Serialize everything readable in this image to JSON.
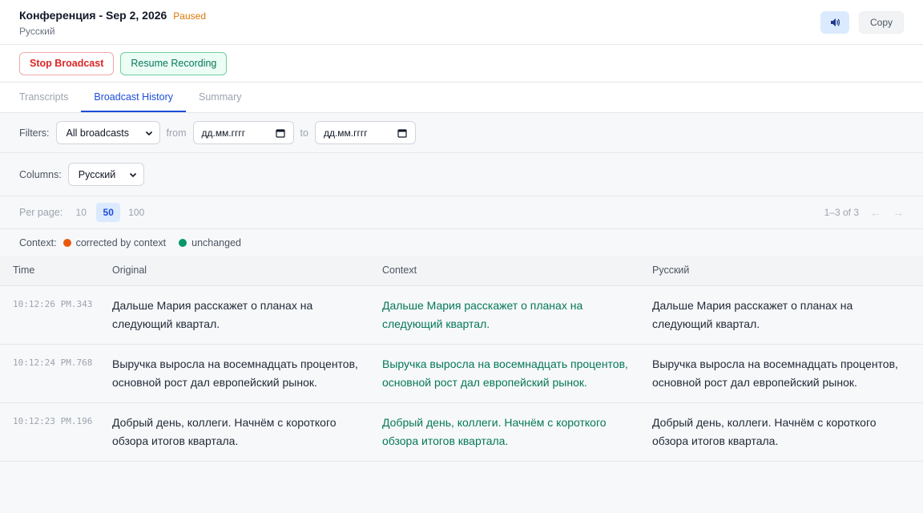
{
  "header": {
    "title": "Конференция - Sep 2, 2026",
    "status": "Paused",
    "language": "Русский",
    "speaker_icon": "speaker-icon",
    "copy_label": "Copy"
  },
  "actions": {
    "stop_label": "Stop Broadcast",
    "resume_label": "Resume Recording"
  },
  "tabs": [
    {
      "label": "Transcripts",
      "active": false
    },
    {
      "label": "Broadcast History",
      "active": true
    },
    {
      "label": "Summary",
      "active": false
    }
  ],
  "filters": {
    "label": "Filters:",
    "broadcast_select": "All broadcasts",
    "from_label": "from",
    "from_placeholder": "дд.мм.гггг",
    "to_label": "to",
    "to_placeholder": "дд.мм.гггг"
  },
  "columns_filter": {
    "label": "Columns:",
    "selected": "Русский"
  },
  "pagination": {
    "label": "Per page:",
    "options": [
      "10",
      "50",
      "100"
    ],
    "selected": "50",
    "range_text": "1–3 of 3",
    "prev_arrow": "←",
    "next_arrow": "→"
  },
  "context_legend": {
    "label": "Context:",
    "corrected": {
      "label": "corrected by context",
      "color": "#ea580c"
    },
    "unchanged": {
      "label": "unchanged",
      "color": "#059669"
    }
  },
  "table": {
    "headers": {
      "time": "Time",
      "original": "Original",
      "context": "Context",
      "translation": "Русский"
    },
    "rows": [
      {
        "time": "10:12:26 PM.343",
        "original": "Дальше Мария расскажет о планах на следующий квартал.",
        "context": "Дальше Мария расскажет о планах на следующий квартал.",
        "translation": "Дальше Мария расскажет о планах на следующий квартал."
      },
      {
        "time": "10:12:24 PM.768",
        "original": "Выручка выросла на восемнадцать процентов, основной рост дал европейский рынок.",
        "context": "Выручка выросла на восемнадцать процентов, основной рост дал европейский рынок.",
        "translation": "Выручка выросла на восемнадцать процентов, основной рост дал европейский рынок."
      },
      {
        "time": "10:12:23 PM.196",
        "original": "Добрый день, коллеги. Начнём с короткого обзора итогов квартала.",
        "context": "Добрый день, коллеги. Начнём с короткого обзора итогов квартала.",
        "translation": "Добрый день, коллеги. Начнём с короткого обзора итогов квартала."
      }
    ]
  }
}
